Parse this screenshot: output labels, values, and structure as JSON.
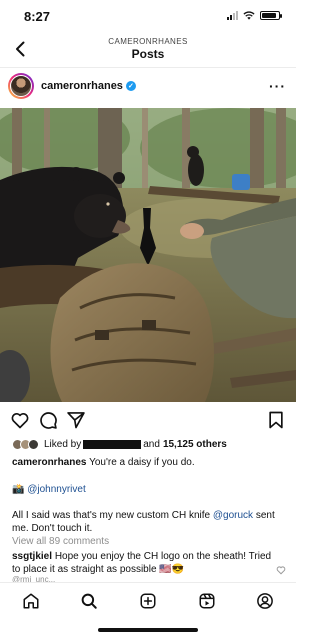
{
  "status_bar": {
    "time": "8:27",
    "battery_level": 0.85
  },
  "header": {
    "account": "CAMERONRHANES",
    "title": "Posts"
  },
  "post": {
    "username": "cameronrhanes",
    "likes": {
      "prefix": "Liked by",
      "suffix": "and",
      "count": "15,125 others"
    },
    "caption": {
      "username": "cameronrhanes",
      "text": "You're a daisy if you do."
    },
    "credit": {
      "emoji": "📸",
      "handle": "@johnnyrivet"
    },
    "body": {
      "part1": "All I said was that's my new custom CH knife",
      "mention": "@goruck",
      "part2": "sent me. Don't touch it."
    },
    "view_comments": "View all 89 comments",
    "comment": {
      "username": "ssgtjkiel",
      "text": "Hope you enjoy the CH logo on the sheath! Tried to place it as straight as possible 🇺🇸😎"
    },
    "mention_partial": "@rmi_unc..."
  },
  "tabs": [
    "home",
    "search",
    "create",
    "reels",
    "profile"
  ]
}
